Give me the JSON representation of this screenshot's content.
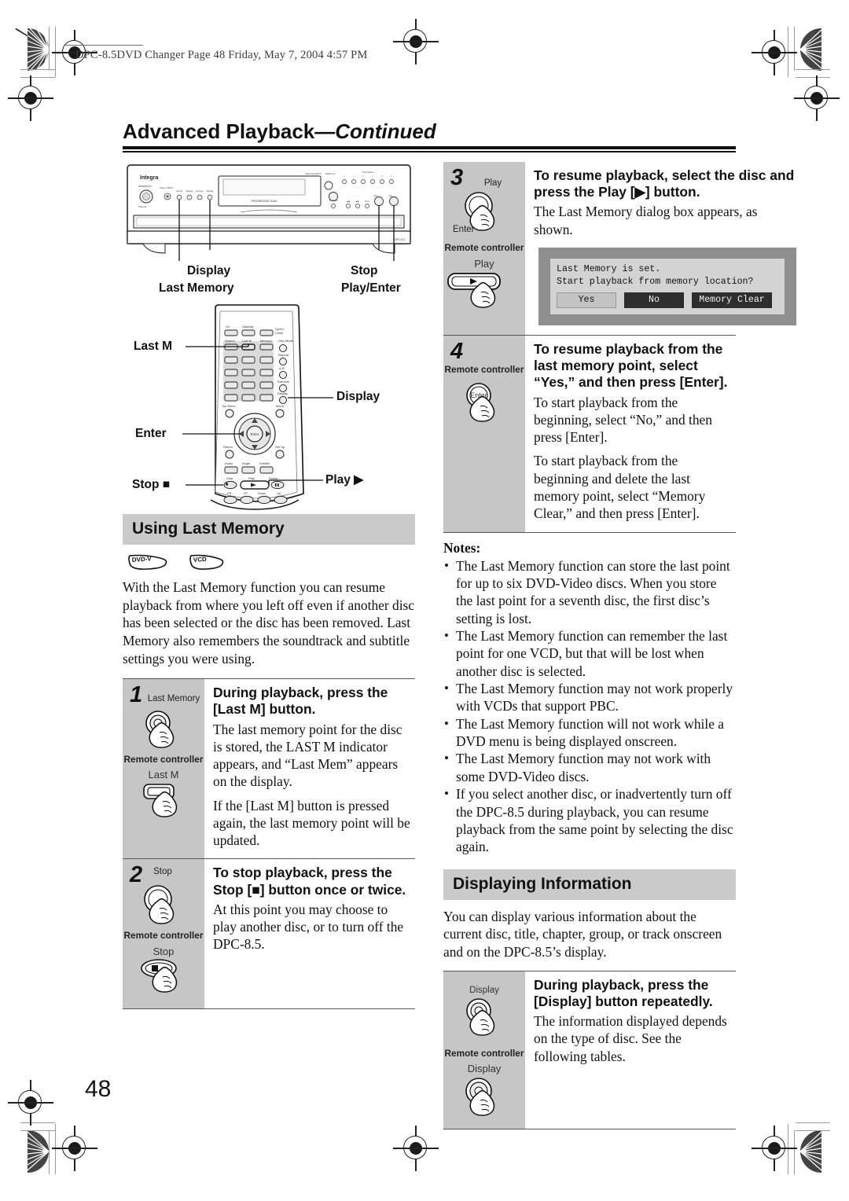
{
  "print_header": {
    "text": "DPC-8.5DVD Changer  Page 48  Friday, May 7, 2004  4:57 PM"
  },
  "chapter": {
    "title_main": "Advanced Playback",
    "title_continued": "—Continued"
  },
  "device_illustration": {
    "brand": "Integra",
    "model_mark": "DPC-8.5",
    "display_text": "PROGRESSIVE SCAN",
    "callouts": {
      "display": "Display",
      "last_memory": "Last Memory",
      "stop": "Stop",
      "play_enter": "Play/Enter"
    }
  },
  "remote_illustration": {
    "callouts": {
      "last_m": "Last M",
      "enter": "Enter",
      "stop": "Stop ■",
      "display": "Display",
      "play": "Play ▶"
    },
    "key_labels": {
      "on": "On",
      "standby": "Standby",
      "open_close": "Open/ Close",
      "search": "Search",
      "last_m": "Last M",
      "memory": "Memory",
      "disc_mode": "Disc Mode",
      "repeat": "Repeat",
      "ab": "A-B",
      "random": "Random",
      "display": "Display",
      "top_menu": "Top Menu",
      "menu": "Menu",
      "return": "Return",
      "setup": "Set Up",
      "audio": "Audio",
      "angle": "Angle",
      "subtitle": "Subtitle",
      "stop": "Stop",
      "play": "Play",
      "pause": "Pause",
      "fr": "FR",
      "ff": "FF",
      "down": "Down",
      "up": "Up"
    }
  },
  "section_last_memory": {
    "heading": "Using Last Memory",
    "disc_icons": [
      "DVD-V",
      "VCD"
    ],
    "intro": "With the Last Memory function you can resume playback from where you left off even if another disc has been selected or the disc has been removed. Last Memory also remembers the soundtrack and subtitle settings you were using.",
    "steps": [
      {
        "number": "1",
        "gutter_label_top": "Last Memory",
        "gutter_caption": "Remote controller",
        "gutter_label_bottom": "Last M",
        "heading": "During playback, press the [Last M] button.",
        "paragraphs": [
          "The last memory point for the disc is stored, the LAST M indicator appears, and “Last Mem” appears on the display.",
          "If the [Last M] button is pressed again, the last memory point will be updated."
        ]
      },
      {
        "number": "2",
        "gutter_label_top": "Stop",
        "gutter_caption": "Remote controller",
        "gutter_label_bottom": "Stop",
        "heading": "To stop playback, press the Stop [■] button once or twice.",
        "paragraphs": [
          "At this point you may choose to play another disc, or to turn off the DPC-8.5."
        ]
      },
      {
        "number": "3",
        "gutter_label_top": "Play",
        "gutter_label_mid": "Enter",
        "gutter_caption": "Remote controller",
        "gutter_label_bottom": "Play",
        "heading": "To resume playback, select the disc and press the Play [▶] button.",
        "paragraphs": [
          "The Last Memory dialog box appears, as shown."
        ],
        "dialog": {
          "line1": "Last Memory is set.",
          "line2": "Start playback from memory location?",
          "buttons": [
            {
              "label": "Yes",
              "style": "light"
            },
            {
              "label": "No",
              "style": "dark"
            },
            {
              "label": "Memory Clear",
              "style": "dark-wide"
            }
          ]
        }
      },
      {
        "number": "4",
        "gutter_caption": "Remote controller",
        "gutter_label_bottom": "Enter",
        "heading": "To resume playback from the last memory point, select “Yes,” and then press [Enter].",
        "paragraphs": [
          "To start playback from the beginning, select “No,” and then press [Enter].",
          "To start playback from the beginning and delete the last memory point, select “Memory Clear,” and then press [Enter]."
        ]
      }
    ],
    "notes_title": "Notes:",
    "notes": [
      "The Last Memory function can store the last point for up to six DVD-Video discs. When you store the last point for a seventh disc, the first disc’s setting is lost.",
      "The Last Memory function can remember the last point for one VCD, but that will be lost when another disc is selected.",
      "The Last Memory function may not work properly with VCDs that support PBC.",
      "The Last Memory function will not work while a DVD menu is being displayed onscreen.",
      "The Last Memory function may not work with some DVD-Video discs.",
      "If you select another disc, or inadvertently turn off the DPC-8.5 during playback, you can resume playback from the same point by selecting the disc again."
    ]
  },
  "section_displaying_information": {
    "heading": "Displaying Information",
    "intro": "You can display various information about the current disc, title, chapter, group, or track onscreen and on the DPC-8.5’s display.",
    "step": {
      "gutter_label_top": "Display",
      "gutter_caption": "Remote controller",
      "gutter_label_bottom": "Display",
      "heading": "During playback, press the [Display] button repeatedly.",
      "paragraphs": [
        "The information displayed depends on the type of disc. See the following tables."
      ]
    }
  },
  "folio": "48",
  "colors": {
    "banner_gray": "#cacaca",
    "gutter_gray": "#c6c6c6",
    "rule_dark": "#565656",
    "osd_surround": "#8f8f8f",
    "osd_panel": "#d3d3d3"
  }
}
